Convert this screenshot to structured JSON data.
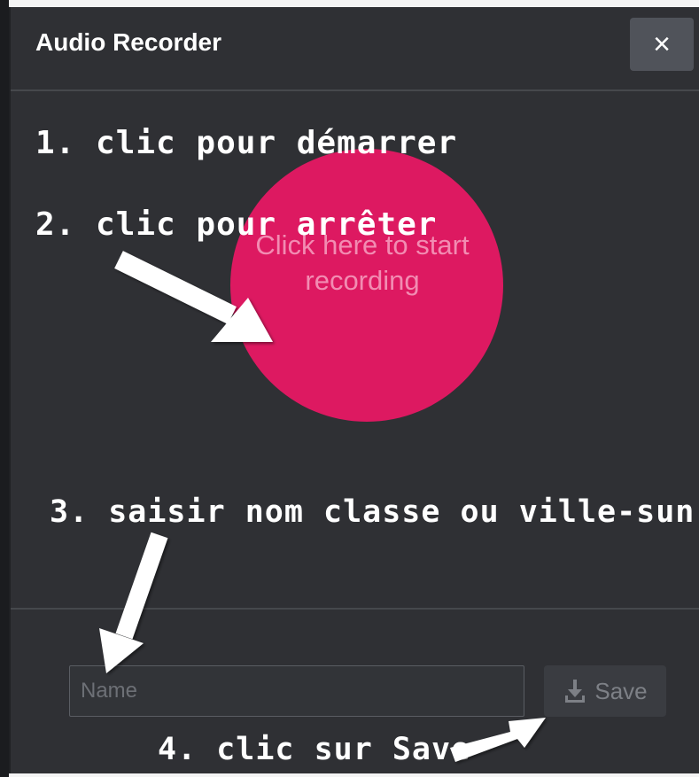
{
  "modal": {
    "title": "Audio Recorder",
    "close_label": "×"
  },
  "annotations": {
    "step1": "1. clic pour démarrer",
    "step2": "2. clic pour arrêter",
    "step3": "3. saisir nom classe ou ville-sun",
    "step4": "4. clic sur Save"
  },
  "recorder": {
    "button_label": "Click here to start recording",
    "button_color": "#dd1961"
  },
  "footer": {
    "name_placeholder": "Name",
    "name_value": "",
    "save_label": "Save",
    "save_icon": "download-icon"
  },
  "colors": {
    "modal_bg": "#2f3034",
    "close_bg": "#50535a",
    "annotation_text": "#ffffff"
  }
}
